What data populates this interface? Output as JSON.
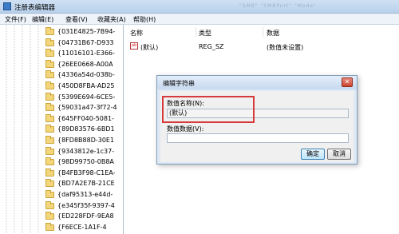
{
  "window": {
    "title": "注册表编辑器",
    "ghost_text": "\"SMB\"  \"SMBPort\"  \"Mode\""
  },
  "menu": [
    "文件(F)",
    "编辑(E)",
    "查看(V)",
    "收藏夹(A)",
    "帮助(H)"
  ],
  "tree": {
    "keys": [
      "{031E4825-7B94-",
      "{04731B67-D933",
      "{11016101-E366-",
      "{26EE0668-A00A",
      "{4336a54d-038b-",
      "{450D8FBA-AD25",
      "{5399E694-6CE5-",
      "{59031a47-3f72-4",
      "{645FF040-5081-",
      "{89D83576-6BD1",
      "{8FD8B88D-30E1",
      "{9343812e-1c37-",
      "{98D99750-0B8A",
      "{B4FB3F98-C1EA-",
      "{BD7A2E7B-21CE",
      "{daf95313-e44d-",
      "{e345f35f-9397-4",
      "{ED228FDF-9EA8",
      "{F6ECE-1A1F-4"
    ]
  },
  "list": {
    "headers": {
      "name": "名称",
      "type": "类型",
      "data": "数据"
    },
    "rows": [
      {
        "name": "(默认)",
        "type": "REG_SZ",
        "data": "(数值未设置)"
      }
    ]
  },
  "dialog": {
    "title": "编辑字符串",
    "close_glyph": "✕",
    "name_label": "数值名称(N):",
    "name_value": "(默认)",
    "data_label": "数值数据(V):",
    "data_value": "",
    "ok_label": "确定",
    "cancel_label": "取消"
  },
  "colors": {
    "highlight": "#d63a3a",
    "titlebar": "#c7d9ef",
    "folder": "#f3d67a"
  }
}
